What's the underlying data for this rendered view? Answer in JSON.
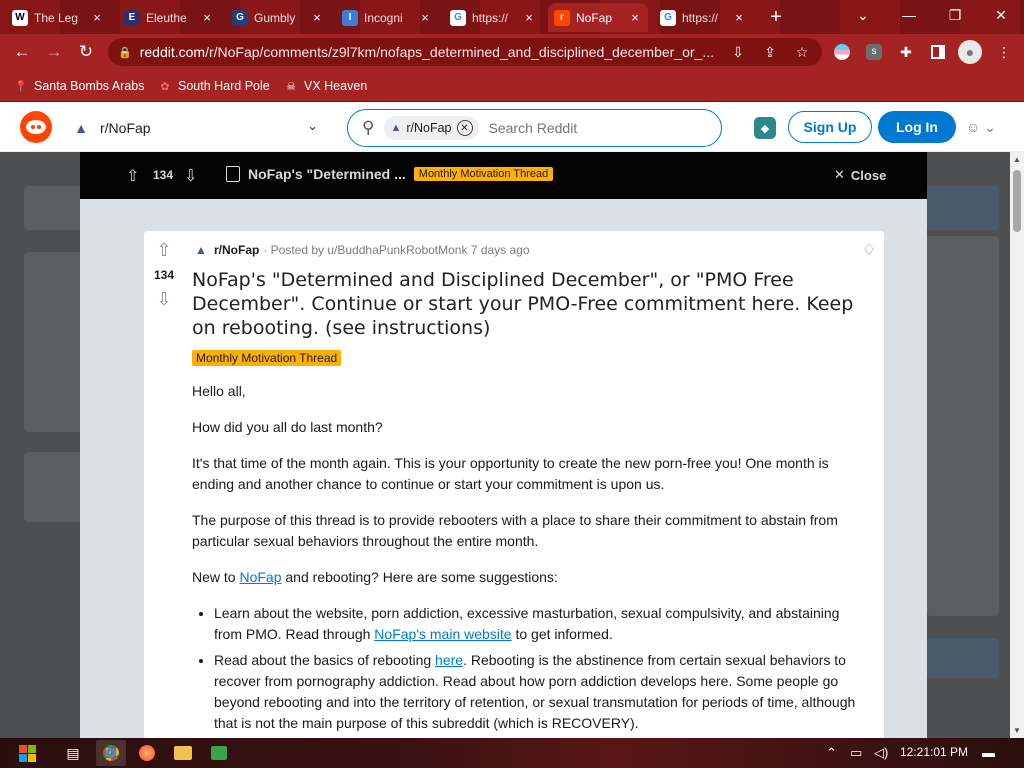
{
  "browser": {
    "tabs": [
      {
        "title": "The Leg",
        "favicon": "W",
        "fav_bg": "#ffffff",
        "fav_fg": "#000000"
      },
      {
        "title": "Eleuthe",
        "favicon": "E",
        "fav_bg": "#2b2f6b",
        "fav_fg": "#ffffff"
      },
      {
        "title": "Gumbly",
        "favicon": "G",
        "fav_bg": "#1f3f7a",
        "fav_fg": "#ffffff"
      },
      {
        "title": "Incogni",
        "favicon": "I",
        "fav_bg": "#3b7dd8",
        "fav_fg": "#ffffff"
      },
      {
        "title": "https://",
        "favicon": "G",
        "fav_bg": "#ffffff",
        "fav_fg": "#4285f4"
      },
      {
        "title": "NoFap",
        "favicon": "r",
        "fav_bg": "#ff4500",
        "fav_fg": "#ffffff",
        "active": true
      },
      {
        "title": "https://",
        "favicon": "G",
        "fav_bg": "#ffffff",
        "fav_fg": "#4285f4"
      }
    ],
    "new_tab": "+",
    "close_glyph": "×",
    "window_controls": {
      "tab_search": "⌄",
      "minimize": "—",
      "restore": "❐",
      "close": "✕"
    },
    "nav": {
      "back": "←",
      "forward": "→",
      "reload": "↻"
    },
    "url": {
      "host": "reddit.com",
      "path": "/r/NoFap/comments/z9l7km/nofaps_determined_and_disciplined_december_or_..."
    },
    "toolbar_icons": [
      "install-icon",
      "share-icon",
      "star-icon",
      "extension-flag-icon",
      "extension-s-icon",
      "puzzle-icon",
      "sidebar-icon",
      "profile-icon",
      "menu-icon"
    ],
    "bookmarks": [
      {
        "label": "Santa Bombs Arabs",
        "icon": "pin-icon"
      },
      {
        "label": "South Hard Pole",
        "icon": "flower-icon"
      },
      {
        "label": "VX Heaven",
        "icon": "skull-icon"
      }
    ]
  },
  "reddit_header": {
    "community": "r/NoFap",
    "search_chip": "r/NoFap",
    "search_placeholder": "Search Reddit",
    "signup": "Sign Up",
    "login": "Log In"
  },
  "overlay": {
    "vote_count": "134",
    "title_short": "NoFap's \"Determined ...",
    "flair": "Monthly Motivation Thread",
    "close": "Close"
  },
  "post": {
    "vote_count": "134",
    "subreddit": "r/NoFap",
    "posted_by": "· Posted by u/BuddhaPunkRobotMonk 7 days ago",
    "title": "NoFap's \"Determined and Disciplined December\", or \"PMO Free December\". Continue or start your PMO-Free commitment here. Keep on rebooting. (see instructions)",
    "flair": "Monthly Motivation Thread",
    "p1": "Hello all,",
    "p2": "How did you all do last month?",
    "p3": "It's that time of the month again. This is your opportunity to create the new porn-free you! One month is ending and another chance to continue or start your commitment is upon us.",
    "p4": "The purpose of this thread is to provide rebooters with a place to share their commitment to abstain from particular sexual behaviors throughout the entire month.",
    "p5_pre": "New to ",
    "p5_link": "NoFap",
    "p5_post": " and rebooting? Here are some suggestions:",
    "li1_pre": "Learn about the website, porn addiction, excessive masturbation, sexual compulsivity, and abstaining from PMO. Read through ",
    "li1_link": "NoFap's main website",
    "li1_post": " to get informed.",
    "li2_pre": "Read about the basics of rebooting ",
    "li2_link": "here",
    "li2_post": ". Rebooting is the abstinence from certain sexual behaviors to recover from pornography addiction. Read about how porn addiction develops here. Some people go beyond rebooting and into the territory of retention, or sexual transmutation for periods of time, although that is not the main purpose of this subreddit (which is RECOVERY)."
  },
  "taskbar": {
    "apps": [
      "task-view-icon",
      "chrome-icon",
      "firefox-icon",
      "explorer-icon",
      "app-icon"
    ],
    "clock": "12:21:01 PM"
  }
}
